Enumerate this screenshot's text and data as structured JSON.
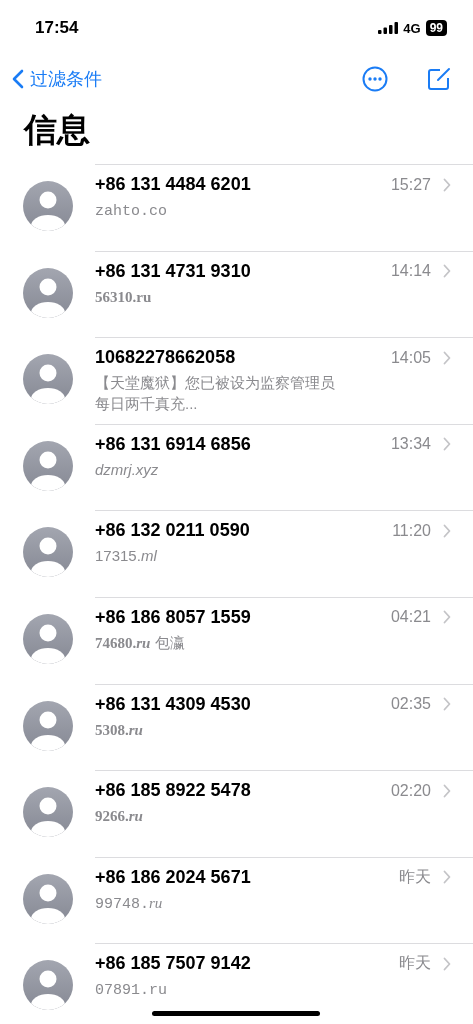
{
  "status_bar": {
    "time": "17:54",
    "network": "4G",
    "battery": "99"
  },
  "nav": {
    "back_label": "过滤条件"
  },
  "title": "信息",
  "conversations": [
    {
      "sender": "+86 131 4484 6201",
      "time": "15:27",
      "preview": [
        {
          "text": "zahto.co",
          "kind": "mono"
        }
      ]
    },
    {
      "sender": "+86 131 4731 9310",
      "time": "14:14",
      "preview": [
        {
          "text": "56310.ru",
          "kind": "serifbold"
        }
      ]
    },
    {
      "sender": "10682278662058",
      "time": "14:05",
      "preview": [
        {
          "text": "【天堂魔狱】您已被设为监察管理员每日两千真充...",
          "kind": "plain"
        }
      ]
    },
    {
      "sender": "+86 131 6914 6856",
      "time": "13:34",
      "preview": [
        {
          "text": "dzmrj.xyz",
          "kind": "italic"
        }
      ]
    },
    {
      "sender": "+86 132 0211 0590",
      "time": "11:20",
      "preview": [
        {
          "text": "17315.",
          "kind": "plain"
        },
        {
          "text": "ml",
          "kind": "italic"
        }
      ]
    },
    {
      "sender": "+86 186 8057 1559",
      "time": "04:21",
      "preview": [
        {
          "text": "74680.",
          "kind": "serifbold"
        },
        {
          "text": "ru",
          "kind": "serifbolditalic"
        },
        {
          "text": " 包瀛",
          "kind": "plain"
        }
      ]
    },
    {
      "sender": "+86 131 4309 4530",
      "time": "02:35",
      "preview": [
        {
          "text": "5308.",
          "kind": "serifbold"
        },
        {
          "text": "ru",
          "kind": "serifbolditalic"
        }
      ]
    },
    {
      "sender": "+86 185 8922 5478",
      "time": "02:20",
      "preview": [
        {
          "text": "9266.",
          "kind": "serifbold"
        },
        {
          "text": "ru",
          "kind": "serifbolditalic"
        }
      ]
    },
    {
      "sender": "+86 186 2024 5671",
      "time": "昨天",
      "preview": [
        {
          "text": "99748.",
          "kind": "mono"
        },
        {
          "text": "ru",
          "kind": "serifitalic"
        }
      ]
    },
    {
      "sender": "+86 185 7507 9142",
      "time": "昨天",
      "preview": [
        {
          "text": "07891.ru",
          "kind": "mono"
        }
      ]
    }
  ]
}
